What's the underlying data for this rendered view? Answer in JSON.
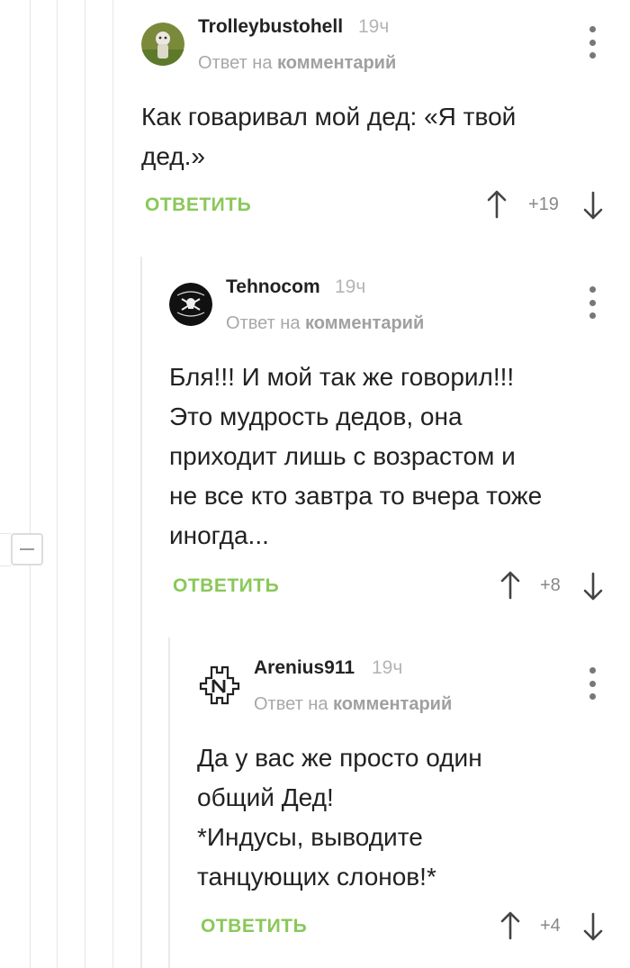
{
  "comments": [
    {
      "username": "Trolleybustohell",
      "time": "19ч",
      "reply_prefix": "Ответ на",
      "reply_link": "комментарий",
      "text": "Как говаривал мой дед: «Я твой\nдед.»",
      "reply_label": "ОТВЕТИТЬ",
      "rating": "+19"
    },
    {
      "username": "Tehnocom",
      "time": "19ч",
      "reply_prefix": "Ответ на",
      "reply_link": "комментарий",
      "text": "Бля!!! И мой так же говорил!!!\nЭто мудрость дедов, она\nприходит лишь с возрастом и\nне все кто завтра то вчера тоже\nиногда...",
      "reply_label": "ОТВЕТИТЬ",
      "rating": "+8"
    },
    {
      "username": "Arenius911",
      "time": "19ч",
      "reply_prefix": "Ответ на",
      "reply_link": "комментарий",
      "text": "Да у вас же просто один\nобщий Дед!\n*Индусы, выводите\nтанцующих слонов!*",
      "reply_label": "ОТВЕТИТЬ",
      "rating": "+4"
    }
  ],
  "colors": {
    "accent": "#8ac858",
    "muted": "#a8a8a8",
    "text": "#222222"
  },
  "icons": {
    "more": "more-vertical-icon",
    "up": "arrow-up-icon",
    "down": "arrow-down-icon",
    "collapse": "minus-icon"
  }
}
